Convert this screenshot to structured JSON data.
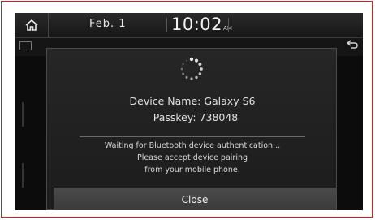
{
  "status_bar": {
    "date": "Feb. 1",
    "time": "10:02",
    "ampm": "AM"
  },
  "popup": {
    "device_name_text": "Device Name: Galaxy S6",
    "passkey_text": "Passkey: 738048",
    "message_lines": [
      "Waiting for Bluetooth device authentication...",
      "Please accept device pairing",
      "from your mobile phone."
    ],
    "close_label": "Close"
  },
  "icons": {
    "home": "home-icon",
    "back": "back-arrow-icon",
    "loading": "loading-spinner-icon",
    "media": "media-icon"
  },
  "colors": {
    "frame_border": "#d81e1e",
    "screen_bg": "#0c0c0c",
    "popup_bg": "#262626",
    "button_bg": "#4a4a4a"
  }
}
